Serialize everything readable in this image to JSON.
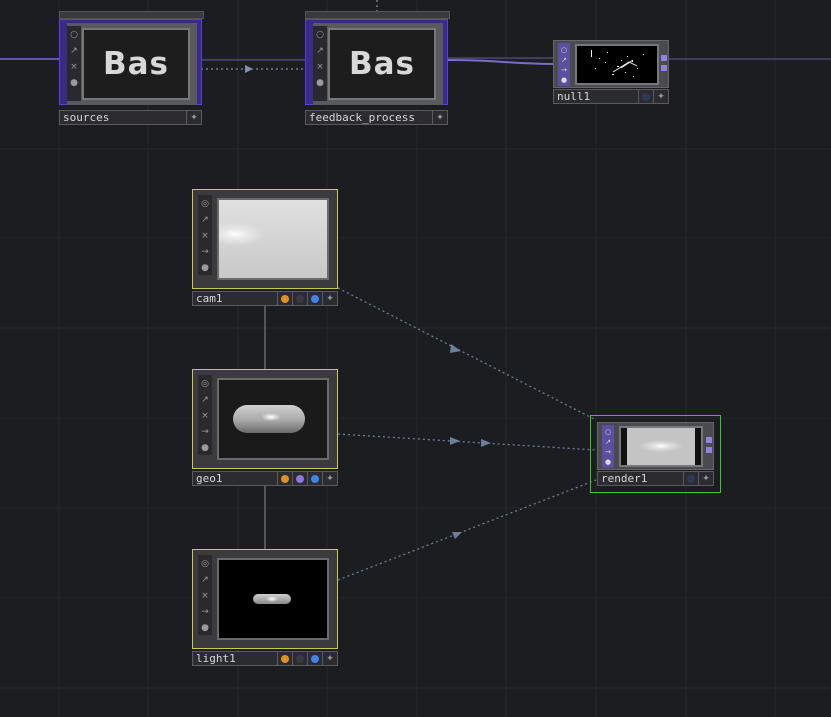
{
  "nodes": {
    "sources": {
      "label": "sources",
      "preview_text": "Bas"
    },
    "feedback": {
      "label": "feedback_process",
      "preview_text": "Bas"
    },
    "null1": {
      "label": "null1"
    },
    "cam1": {
      "label": "cam1"
    },
    "geo1": {
      "label": "geo1"
    },
    "light1": {
      "label": "light1"
    },
    "render1": {
      "label": "render1"
    }
  },
  "colors": {
    "background": "#1c1d21",
    "grid_line": "#25262b",
    "selected_border": "#c9c94a",
    "active_border": "#2ecc2e",
    "base_comp": "#5b3ee0",
    "wire": "#6c7f99",
    "dot_orange": "#e0902a",
    "dot_purple": "#8a7ae0",
    "dot_blue": "#3f86e8"
  }
}
